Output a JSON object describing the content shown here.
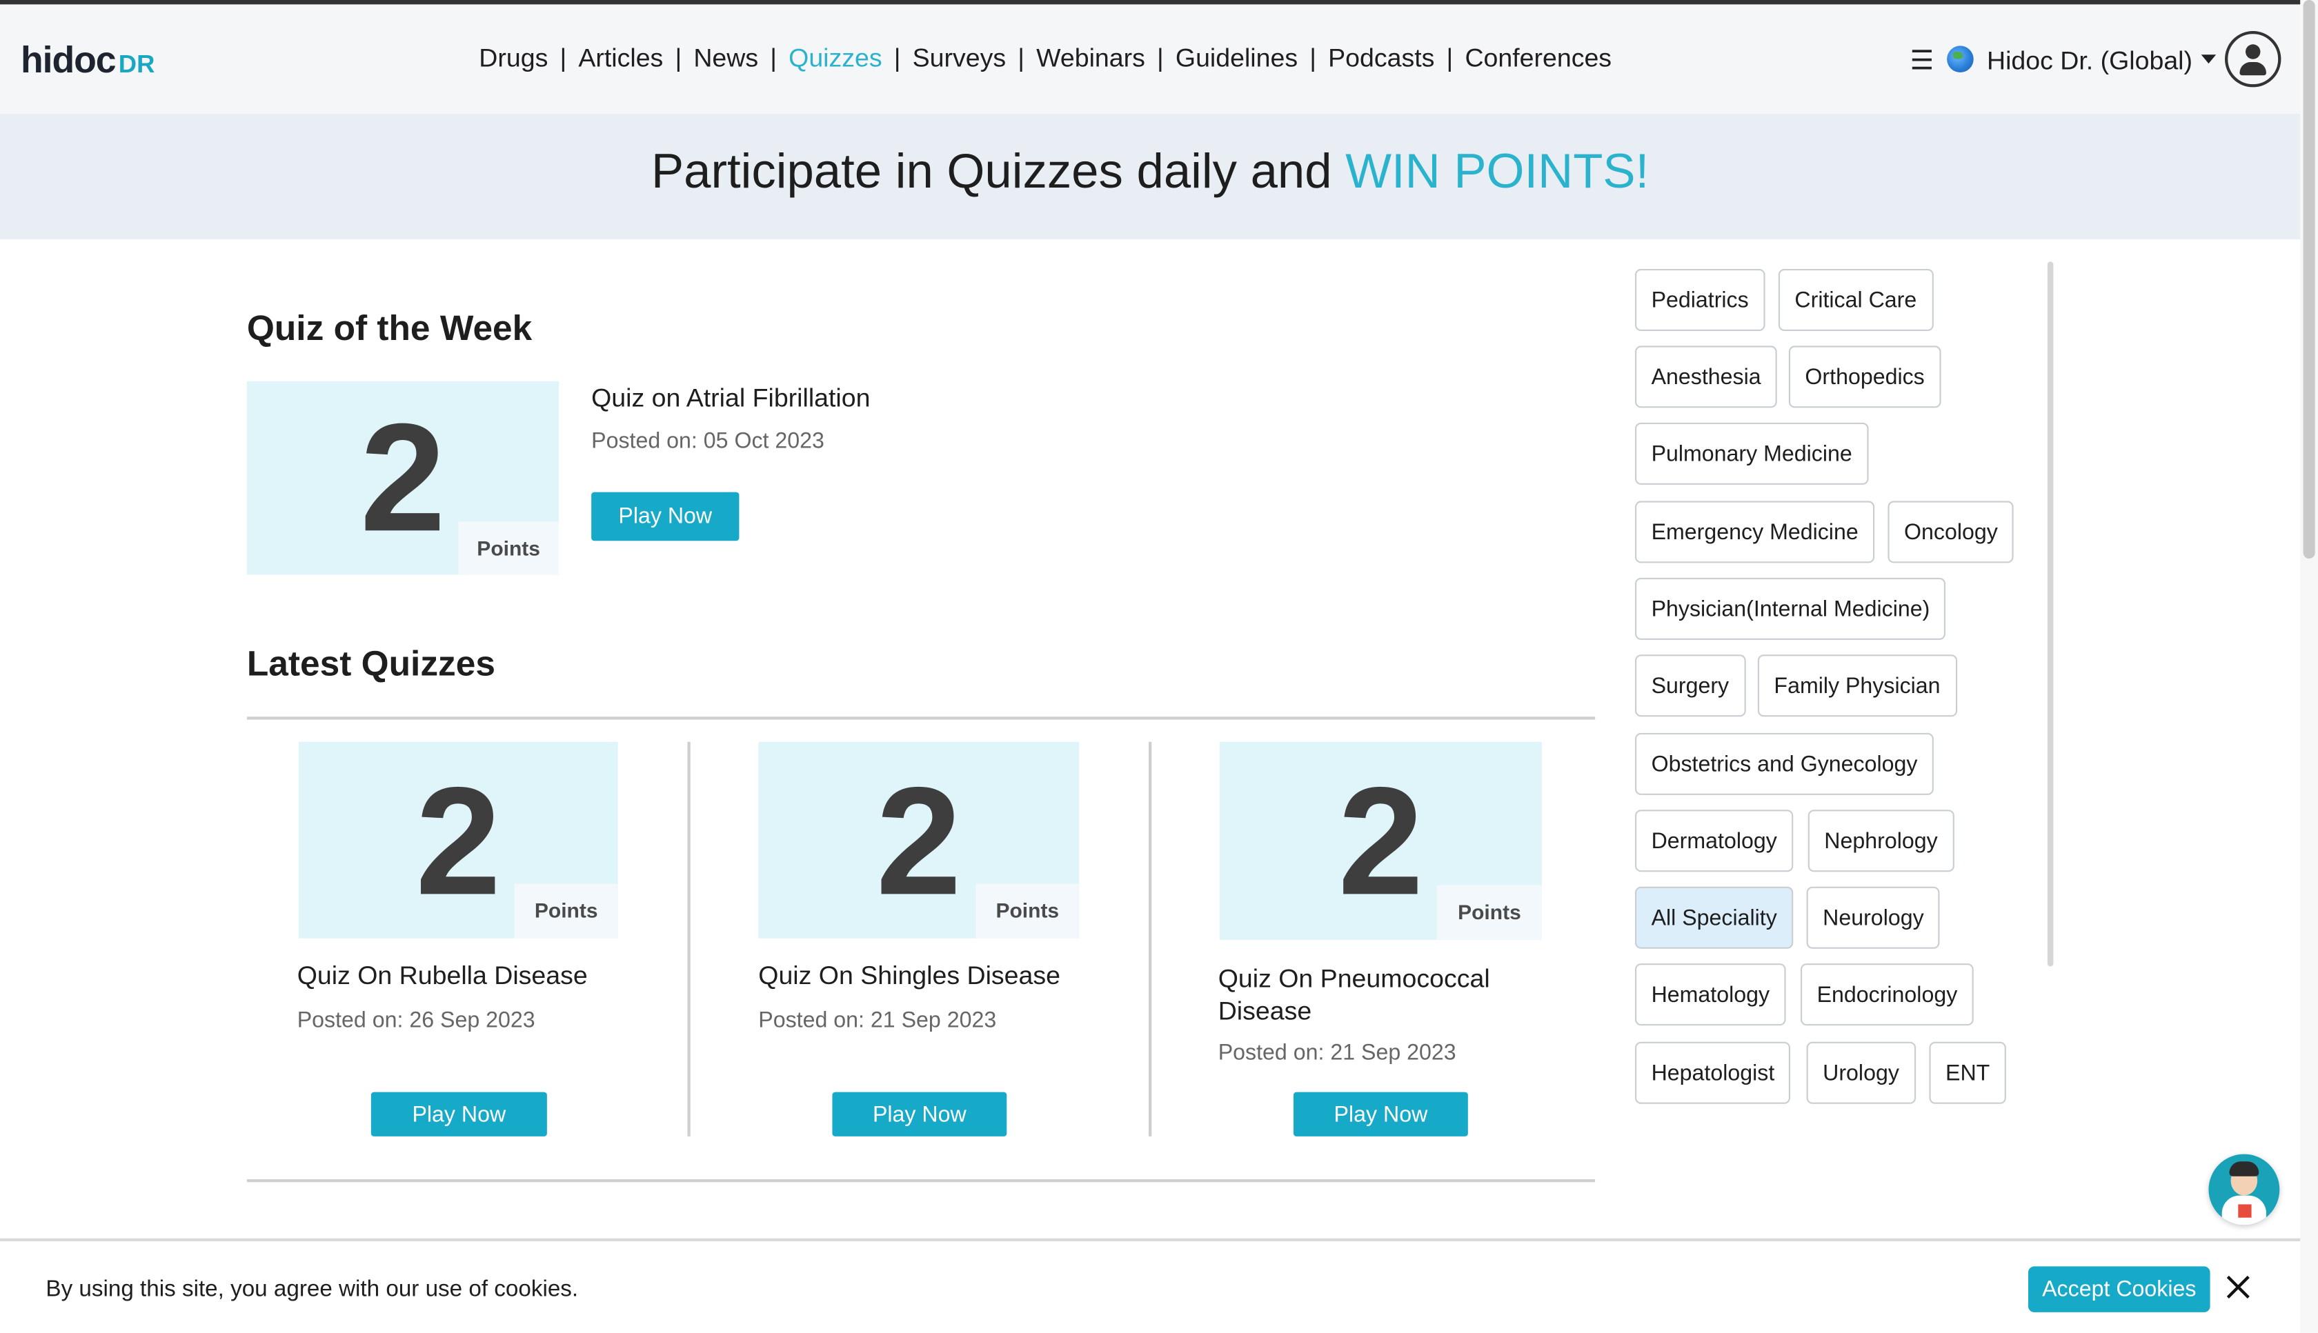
{
  "header": {
    "logo_main": "hidoc",
    "logo_suffix": "DR",
    "nav": [
      {
        "label": "Drugs",
        "active": false
      },
      {
        "label": "Articles",
        "active": false
      },
      {
        "label": "News",
        "active": false
      },
      {
        "label": "Quizzes",
        "active": true
      },
      {
        "label": "Surveys",
        "active": false
      },
      {
        "label": "Webinars",
        "active": false
      },
      {
        "label": "Guidelines",
        "active": false
      },
      {
        "label": "Podcasts",
        "active": false
      },
      {
        "label": "Conferences",
        "active": false
      }
    ],
    "nav_separator": "|",
    "menu_icon": "☰",
    "region": "Hidoc Dr. (Global)"
  },
  "banner": {
    "text": "Participate in Quizzes daily and",
    "accent": "WIN POINTS!"
  },
  "quiz_of_week": {
    "heading": "Quiz of the Week",
    "points": "2",
    "points_label": "Points",
    "title": "Quiz on Atrial Fibrillation",
    "posted": "Posted on: 05 Oct 2023",
    "button": "Play Now"
  },
  "latest": {
    "heading": "Latest Quizzes",
    "items": [
      {
        "points": "2",
        "points_label": "Points",
        "title": "Quiz On Rubella Disease",
        "posted": "Posted on: 26 Sep 2023",
        "button": "Play Now"
      },
      {
        "points": "2",
        "points_label": "Points",
        "title": "Quiz On Shingles Disease",
        "posted": "Posted on: 21 Sep 2023",
        "button": "Play Now"
      },
      {
        "points": "2",
        "points_label": "Points",
        "title": "Quiz On Pneumococcal Disease",
        "posted": "Posted on: 21 Sep 2023",
        "button": "Play Now"
      }
    ]
  },
  "specialities": {
    "selected": "All Speciality",
    "tags": [
      "Pediatrics",
      "Critical Care",
      "Anesthesia",
      "Orthopedics",
      "Pulmonary Medicine",
      "Emergency Medicine",
      "Oncology",
      "Physician(Internal Medicine)",
      "Surgery",
      "Family Physician",
      "Obstetrics and Gynecology",
      "Dermatology",
      "Nephrology",
      "All Speciality",
      "Neurology",
      "Hematology",
      "Endocrinology",
      "Hepatologist",
      "Urology",
      "ENT"
    ]
  },
  "cookie": {
    "text": "By using this site, you agree with our use of cookies.",
    "accept": "Accept Cookies"
  },
  "colors": {
    "accent": "#2bb3ce",
    "button": "#17a9c8",
    "points_bg": "#e0f5fa",
    "banner_bg": "#e9eef5"
  }
}
